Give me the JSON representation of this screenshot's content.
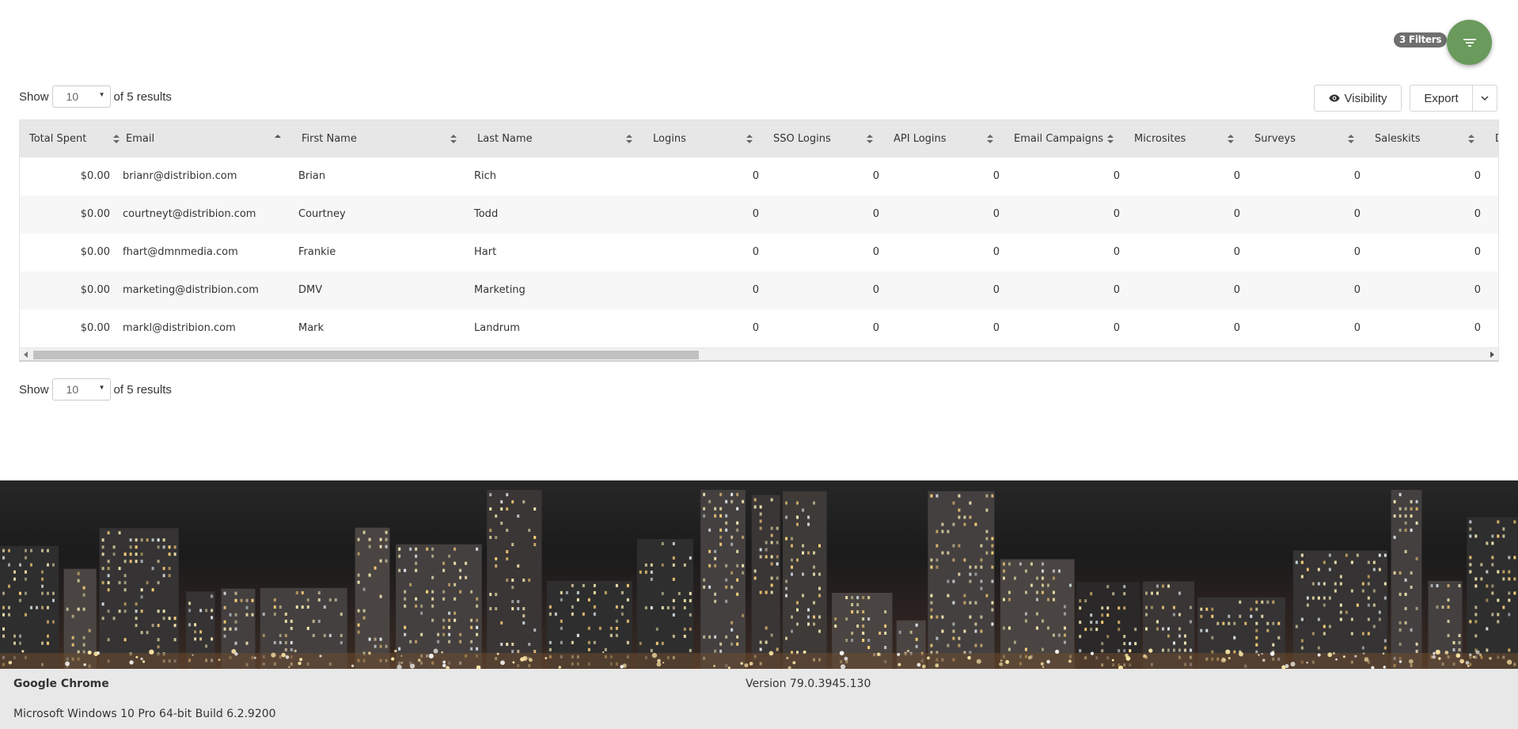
{
  "filters": {
    "badge": "3 Filters",
    "icon": "filter-lines-icon",
    "accent": "#6a9a5c"
  },
  "pager_top": {
    "show_label": "Show",
    "page_size": "10",
    "results_label": "of 5 results"
  },
  "pager_bottom": {
    "show_label": "Show",
    "page_size": "10",
    "results_label": "of 5 results"
  },
  "toolbar": {
    "visibility_label": "Visibility",
    "export_label": "Export"
  },
  "table": {
    "columns": [
      "Total Spent",
      "Email",
      "First Name",
      "Last Name",
      "Logins",
      "SSO Logins",
      "API Logins",
      "Email Campaigns",
      "Microsites",
      "Surveys",
      "Saleskits",
      "D"
    ],
    "rows": [
      [
        "$0.00",
        "brianr@distribion.com",
        "Brian",
        "Rich",
        "0",
        "0",
        "0",
        "0",
        "0",
        "0",
        "0"
      ],
      [
        "$0.00",
        "courtneyt@distribion.com",
        "Courtney",
        "Todd",
        "0",
        "0",
        "0",
        "0",
        "0",
        "0",
        "0"
      ],
      [
        "$0.00",
        "fhart@dmnmedia.com",
        "Frankie",
        "Hart",
        "0",
        "0",
        "0",
        "0",
        "0",
        "0",
        "0"
      ],
      [
        "$0.00",
        "marketing@distribion.com",
        "DMV",
        "Marketing",
        "0",
        "0",
        "0",
        "0",
        "0",
        "0",
        "0"
      ],
      [
        "$0.00",
        "markl@distribion.com",
        "Mark",
        "Landrum",
        "0",
        "0",
        "0",
        "0",
        "0",
        "0",
        "0"
      ]
    ]
  },
  "footer": {
    "browser": "Google Chrome",
    "version": "Version 79.0.3945.130",
    "os": "Microsoft Windows 10 Pro 64-bit Build 6.2.9200"
  }
}
